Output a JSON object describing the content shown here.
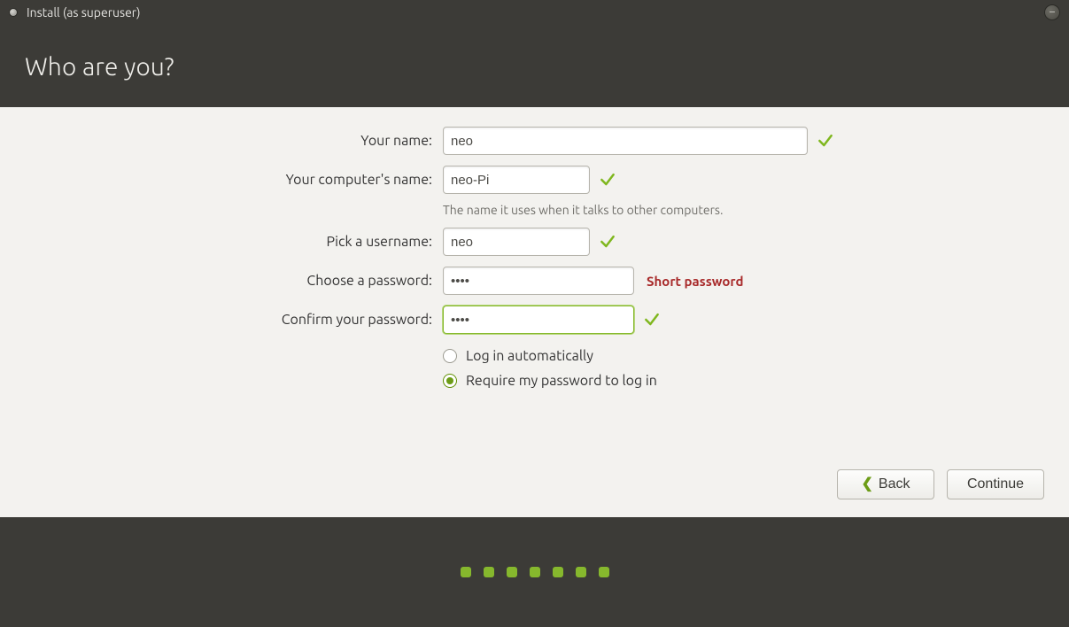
{
  "window": {
    "title": "Install (as superuser)",
    "heading": "Who are you?"
  },
  "form": {
    "name": {
      "label": "Your name:",
      "value": "neo"
    },
    "computer": {
      "label": "Your computer's name:",
      "value": "neo-Pi",
      "hint": "The name it uses when it talks to other computers."
    },
    "username": {
      "label": "Pick a username:",
      "value": "neo"
    },
    "password": {
      "label": "Choose a password:",
      "value": "••••",
      "warning": "Short password"
    },
    "confirm": {
      "label": "Confirm your password:",
      "value": "••••"
    },
    "login_options": {
      "auto": "Log in automatically",
      "require": "Require my password to log in",
      "selected": "require"
    }
  },
  "buttons": {
    "back": "Back",
    "continue": "Continue"
  },
  "progress": {
    "steps": 7
  }
}
